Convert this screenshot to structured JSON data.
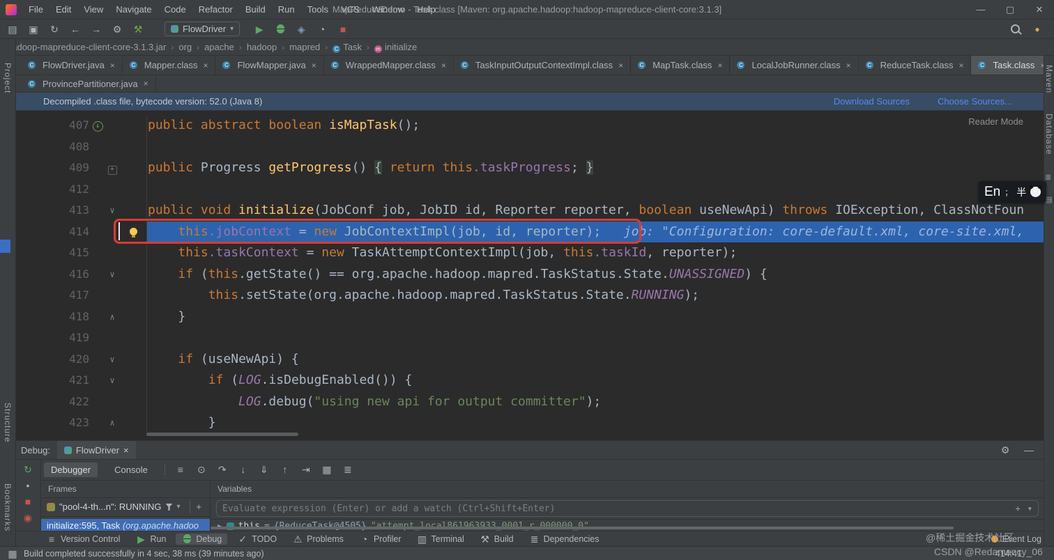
{
  "window": {
    "title": "MapReduceDemo - Task.class [Maven: org.apache.hadoop:hadoop-mapreduce-client-core:3.1.3]",
    "menu": [
      "File",
      "Edit",
      "View",
      "Navigate",
      "Code",
      "Refactor",
      "Build",
      "Run",
      "Tools",
      "VCS",
      "Window",
      "Help"
    ],
    "controls": {
      "minimize": "—",
      "maximize": "▢",
      "close": "✕"
    }
  },
  "toolbar": {
    "left_icons": [
      "open-folder-icon",
      "save-all-icon",
      "sync-icon",
      "back-icon",
      "forward-icon",
      "settings-icon",
      "build-icon"
    ],
    "run_config": "FlowDriver",
    "run_icons": [
      "run-icon",
      "debug-icon",
      "coverage-icon",
      "profiler-icon",
      "stop-icon"
    ],
    "right_icons": [
      "search-icon",
      "updates-icon"
    ]
  },
  "breadcrumbs": [
    {
      "label": "hadoop-mapreduce-client-core-3.1.3.jar"
    },
    {
      "label": "org"
    },
    {
      "label": "apache"
    },
    {
      "label": "hadoop"
    },
    {
      "label": "mapred"
    },
    {
      "label": "Task",
      "icon": "class-icon"
    },
    {
      "label": "initialize",
      "icon": "method-icon"
    }
  ],
  "tabs": {
    "row1": [
      {
        "label": "FlowDriver.java"
      },
      {
        "label": "Mapper.class"
      },
      {
        "label": "FlowMapper.java"
      },
      {
        "label": "WrappedMapper.class"
      },
      {
        "label": "TaskInputOutputContextImpl.class"
      },
      {
        "label": "MapTask.class"
      },
      {
        "label": "LocalJobRunner.class"
      },
      {
        "label": "ReduceTask.class"
      },
      {
        "label": "Task.class",
        "active": true
      }
    ],
    "row2": [
      {
        "label": "ProvincePartitioner.java"
      }
    ]
  },
  "notification": {
    "message": "Decompiled .class file, bytecode version: 52.0 (Java 8)",
    "links": [
      "Download Sources",
      "Choose Sources..."
    ]
  },
  "editor": {
    "reader_mode": "Reader Mode",
    "lines": [
      {
        "num": "407",
        "badge": "override-method-icon",
        "tokens": [
          [
            "k",
            "public abstract boolean "
          ],
          [
            "m",
            "isMapTask"
          ],
          [
            "p",
            "();"
          ]
        ]
      },
      {
        "num": "408",
        "tokens": []
      },
      {
        "num": "409",
        "fold": "plus",
        "tokens": [
          [
            "k",
            "public "
          ],
          [
            "p",
            "Progress "
          ],
          [
            "m",
            "getProgress"
          ],
          [
            "p",
            "() "
          ],
          [
            "b",
            "{"
          ],
          [
            "k",
            " return "
          ],
          [
            "k",
            "this"
          ],
          [
            "f",
            ".taskProgress"
          ],
          [
            "p",
            "; "
          ],
          [
            "b",
            "}"
          ]
        ]
      },
      {
        "num": "412",
        "tokens": []
      },
      {
        "num": "413",
        "fold": "down",
        "tokens": [
          [
            "k",
            "public void "
          ],
          [
            "m",
            "initialize"
          ],
          [
            "p",
            "(JobConf job, JobID id, Reporter reporter, "
          ],
          [
            "k",
            "boolean"
          ],
          [
            "p",
            " useNewApi) "
          ],
          [
            "k",
            "throws"
          ],
          [
            "p",
            " IOException, ClassNotFoun"
          ]
        ]
      },
      {
        "num": "414",
        "bulb": true,
        "exec": true,
        "tokens": [
          [
            "p",
            "    "
          ],
          [
            "k",
            "this"
          ],
          [
            "f",
            ".jobContext"
          ],
          [
            "p",
            " = "
          ],
          [
            "k",
            "new"
          ],
          [
            "p",
            " JobContextImpl(job, id, reporter);"
          ],
          [
            "h",
            "   job: \"Configuration: core-default.xml, core-site.xml,"
          ]
        ]
      },
      {
        "num": "415",
        "tokens": [
          [
            "p",
            "    "
          ],
          [
            "k",
            "this"
          ],
          [
            "f",
            ".taskContext"
          ],
          [
            "p",
            " = "
          ],
          [
            "k",
            "new"
          ],
          [
            "p",
            " TaskAttemptContextImpl(job, "
          ],
          [
            "k",
            "this"
          ],
          [
            "f",
            ".taskId"
          ],
          [
            "p",
            ", reporter);"
          ]
        ]
      },
      {
        "num": "416",
        "fold": "down",
        "tokens": [
          [
            "p",
            "    "
          ],
          [
            "k",
            "if"
          ],
          [
            "p",
            " ("
          ],
          [
            "k",
            "this"
          ],
          [
            "p",
            ".getState() == org.apache.hadoop.mapred.TaskStatus.State."
          ],
          [
            "c",
            "UNASSIGNED"
          ],
          [
            "p",
            ") {"
          ]
        ]
      },
      {
        "num": "417",
        "tokens": [
          [
            "p",
            "        "
          ],
          [
            "k",
            "this"
          ],
          [
            "p",
            ".setState(org.apache.hadoop.mapred.TaskStatus.State."
          ],
          [
            "c",
            "RUNNING"
          ],
          [
            "p",
            ");"
          ]
        ]
      },
      {
        "num": "418",
        "fold": "up",
        "tokens": [
          [
            "p",
            "    }"
          ]
        ]
      },
      {
        "num": "419",
        "tokens": []
      },
      {
        "num": "420",
        "fold": "down",
        "tokens": [
          [
            "p",
            "    "
          ],
          [
            "k",
            "if"
          ],
          [
            "p",
            " (useNewApi) {"
          ]
        ]
      },
      {
        "num": "421",
        "fold": "down",
        "tokens": [
          [
            "p",
            "        "
          ],
          [
            "k",
            "if"
          ],
          [
            "p",
            " ("
          ],
          [
            "st",
            "LOG"
          ],
          [
            "p",
            ".isDebugEnabled()) {"
          ]
        ]
      },
      {
        "num": "422",
        "tokens": [
          [
            "p",
            "            "
          ],
          [
            "st",
            "LOG"
          ],
          [
            "p",
            ".debug("
          ],
          [
            "s",
            "\"using new api for output committer\""
          ],
          [
            "p",
            ");"
          ]
        ]
      },
      {
        "num": "423",
        "fold": "up",
        "tokens": [
          [
            "p",
            "        }"
          ]
        ]
      }
    ]
  },
  "debug": {
    "panel_label": "Debug:",
    "session_tab": "FlowDriver",
    "view_tabs": [
      {
        "label": "Debugger",
        "active": true
      },
      {
        "label": "Console"
      }
    ],
    "toolbar_icons": [
      "settings-menu-icon",
      "show-execution-point-icon",
      "step-over-icon",
      "step-into-icon",
      "force-step-into-icon",
      "step-out-icon",
      "run-to-cursor-icon",
      "view-as-table-icon",
      "threads-view-icon"
    ],
    "left_icons": [
      "rerun-icon",
      "resume-icon",
      "stop-icon",
      "view-breakpoints-icon"
    ],
    "frames": {
      "header": "Frames",
      "thread": "\"pool-4-th...n\": RUNNING",
      "selected_frame": {
        "method": "initialize:595, Task ",
        "location": "(org.apache.hadoo"
      }
    },
    "variables": {
      "header": "Variables",
      "evaluate_placeholder": "Evaluate expression (Enter) or add a watch (Ctrl+Shift+Enter)",
      "item": {
        "name": "this",
        "eq": " = ",
        "ref": "{ReduceTask@4505} ",
        "value": "\"attempt_local861963933_0001_r_000000_0\""
      }
    }
  },
  "status_bar": {
    "tools": [
      {
        "label": "Version Control",
        "icon": "version-control-icon"
      },
      {
        "label": "Run",
        "icon": "run-icon"
      },
      {
        "label": "Debug",
        "icon": "debug-icon",
        "active": true
      },
      {
        "label": "TODO",
        "icon": "todo-icon"
      },
      {
        "label": "Problems",
        "icon": "problems-icon"
      },
      {
        "label": "Profiler",
        "icon": "profiler-icon"
      },
      {
        "label": "Terminal",
        "icon": "terminal-icon"
      },
      {
        "label": "Build",
        "icon": "build-icon"
      },
      {
        "label": "Dependencies",
        "icon": "dependencies-icon"
      }
    ],
    "event_log": "Event Log",
    "message": "Build completed successfully in 4 sec, 38 ms (39 minutes ago)",
    "caret_position": "414:41"
  },
  "stripes": {
    "left": [
      "Project",
      "Structure",
      "Bookmarks"
    ],
    "right": [
      "Maven",
      "Database"
    ]
  },
  "ime": {
    "lang": "En",
    "punct": "；",
    "width_mode": "半"
  },
  "watermarks": {
    "top": "@稀土掘金技术社区",
    "bottom": "CSDN @Redamancy_06"
  }
}
